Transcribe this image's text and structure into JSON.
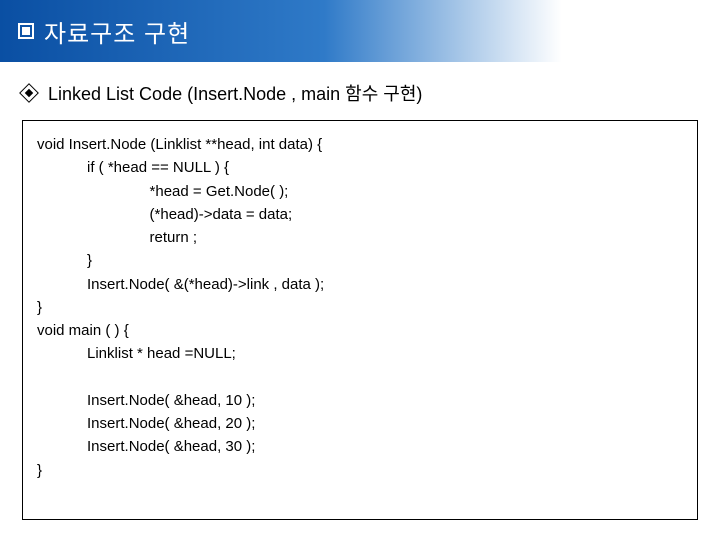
{
  "title": "자료구조 구현",
  "subtitle": "Linked List Code (Insert.Node , main 함수 구현)",
  "code_block_1": "void Insert.Node (Linklist **head, int data) {\n            if ( *head == NULL ) {\n                           *head = Get.Node( );\n                           (*head)->data = data;\n                           return ;\n            }\n            Insert.Node( &(*head)->link , data );\n}",
  "code_block_2": "void main ( ) {\n            Linklist * head =NULL;\n\n            Insert.Node( &head, 10 );\n            Insert.Node( &head, 20 );\n            Insert.Node( &head, 30 );\n}"
}
